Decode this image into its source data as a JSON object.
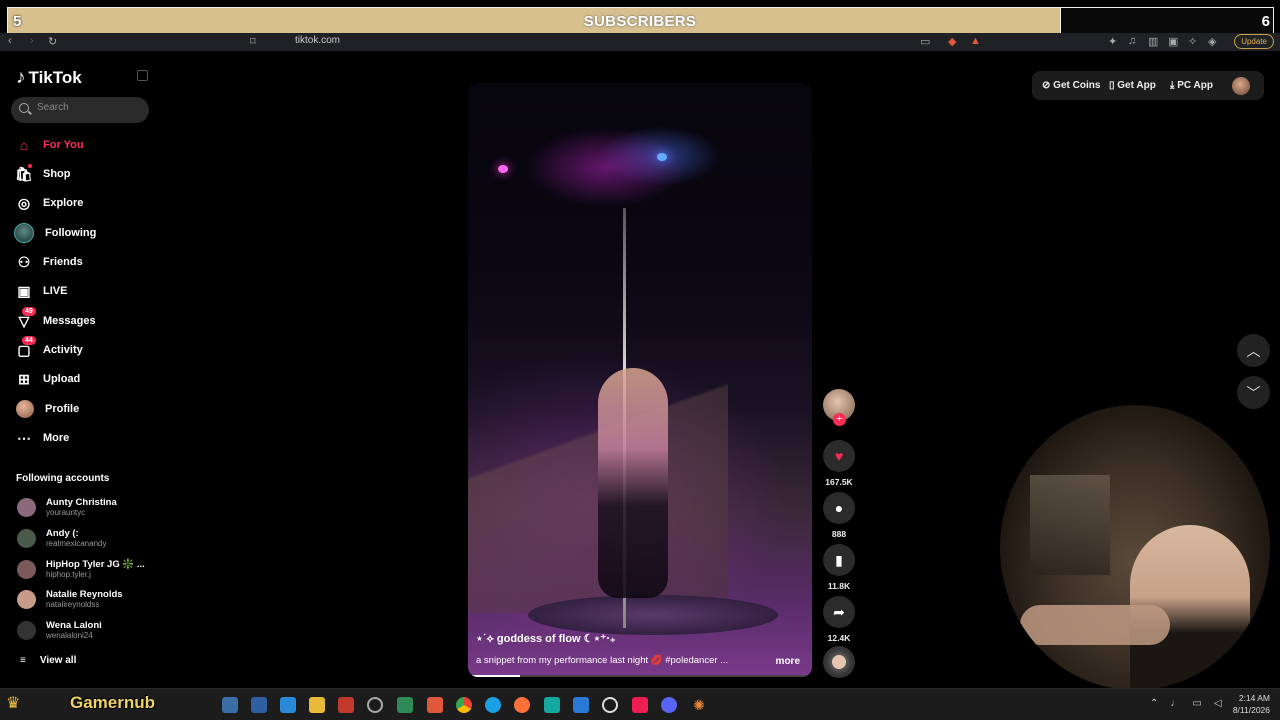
{
  "overlay": {
    "left_count": "5",
    "title": "SUBSCRIBERS",
    "right_count": "6"
  },
  "browser": {
    "url": "tiktok.com",
    "update_label": "Update"
  },
  "sidebar": {
    "logo_text": "TikTok",
    "search_placeholder": "Search",
    "items": [
      {
        "label": "For You",
        "icon": "home-icon",
        "active": true
      },
      {
        "label": "Shop",
        "icon": "shop-icon"
      },
      {
        "label": "Explore",
        "icon": "compass-icon"
      },
      {
        "label": "Following",
        "icon": "following-avatar-icon"
      },
      {
        "label": "Friends",
        "icon": "friends-icon"
      },
      {
        "label": "LIVE",
        "icon": "live-icon"
      },
      {
        "label": "Messages",
        "icon": "messages-icon",
        "badge": "49"
      },
      {
        "label": "Activity",
        "icon": "activity-icon",
        "badge": "44"
      },
      {
        "label": "Upload",
        "icon": "upload-icon"
      },
      {
        "label": "Profile",
        "icon": "profile-avatar-icon"
      },
      {
        "label": "More",
        "icon": "more-icon"
      }
    ],
    "following_title": "Following accounts",
    "accounts": [
      {
        "name": "Aunty Christina",
        "handle": "yourauntyc",
        "color": "#8a6a7a"
      },
      {
        "name": "Andy (:",
        "handle": "realmexicanandy",
        "color": "#4a5a4a"
      },
      {
        "name": "HipHop Tyler JG ❇️ ...",
        "handle": "hiphop.tyler.j",
        "color": "#7a5a5a"
      },
      {
        "name": "Natalie Reynolds",
        "handle": "natalireynoldss",
        "color": "#c89a8a"
      },
      {
        "name": "Wena Laloni",
        "handle": "wenalaloni24",
        "color": "#333333"
      }
    ],
    "view_all": "View all"
  },
  "topbar": {
    "get_coins": "Get Coins",
    "get_app": "Get App",
    "pc_app": "PC App"
  },
  "video": {
    "title": "⋆˙⟡ goddess of flow ☾⋆⁺‧₊",
    "description": "a snippet from my performance last night 💋 #poledancer ...",
    "more": "more",
    "progress": 0.15
  },
  "actions": {
    "likes": "167.5K",
    "comments": "888",
    "saves": "11.8K",
    "shares": "12.4K"
  },
  "taskbar": {
    "label": "Gamernub",
    "time": "2:14 AM",
    "date": "8/11/2026"
  }
}
